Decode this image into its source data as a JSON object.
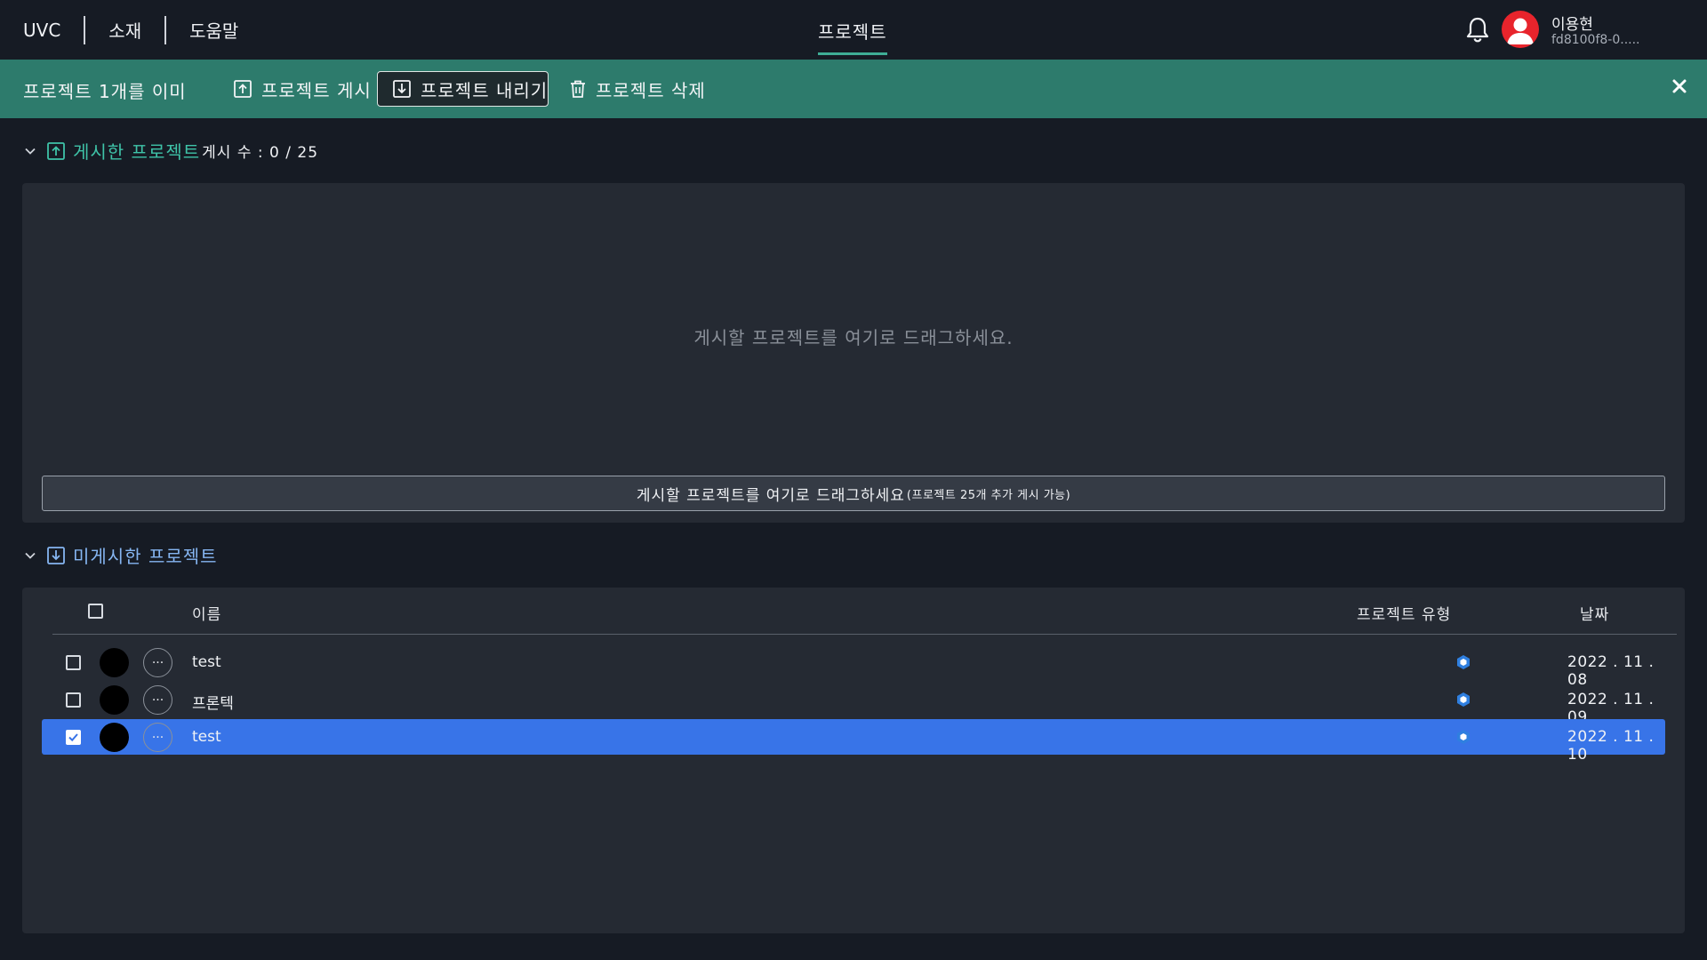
{
  "header": {
    "nav": [
      "UVC",
      "소재",
      "도움말"
    ],
    "center_tab": "프로젝트",
    "user": {
      "name": "이용현",
      "id": "fd8100f8-0....."
    }
  },
  "action_bar": {
    "selection_text": "프로젝트 1개를 이미",
    "publish_label": "프로젝트 게시",
    "unpublish_label": "프로젝트 내리기",
    "delete_label": "프로젝트 삭제"
  },
  "published": {
    "title": "게시한 프로젝트",
    "count_text": "게시 수 : 0 / 25",
    "drop_hint": "게시할 프로젝트를 여기로 드래그하세요.",
    "drop_bar_main": "게시할 프로젝트를 여기로 드래그하세요",
    "drop_bar_sub": "(프로젝트 25개 추가 게시 가능)"
  },
  "unpublished": {
    "title": "미게시한 프로젝트",
    "columns": {
      "name": "이름",
      "type": "프로젝트 유형",
      "date": "날짜"
    },
    "rows": [
      {
        "name": "test",
        "date": "2022 . 11 . 08",
        "checked": false,
        "selected": false
      },
      {
        "name": "프론텍",
        "date": "2022 . 11 . 09",
        "checked": false,
        "selected": false
      },
      {
        "name": "test",
        "date": "2022 . 11 . 10",
        "checked": true,
        "selected": true
      }
    ]
  },
  "colors": {
    "background": "#161b24",
    "action_bar": "#2d7b6c",
    "accent_green": "#3fc3a8",
    "accent_blue": "#86b6f2",
    "selected_row": "#3874e8",
    "avatar_red": "#e8242c"
  },
  "icons": [
    "bell-icon",
    "user-avatar-icon",
    "upload-icon",
    "download-icon",
    "trash-icon",
    "close-icon",
    "chevron-down-icon",
    "more-icon",
    "project-type-icon"
  ]
}
